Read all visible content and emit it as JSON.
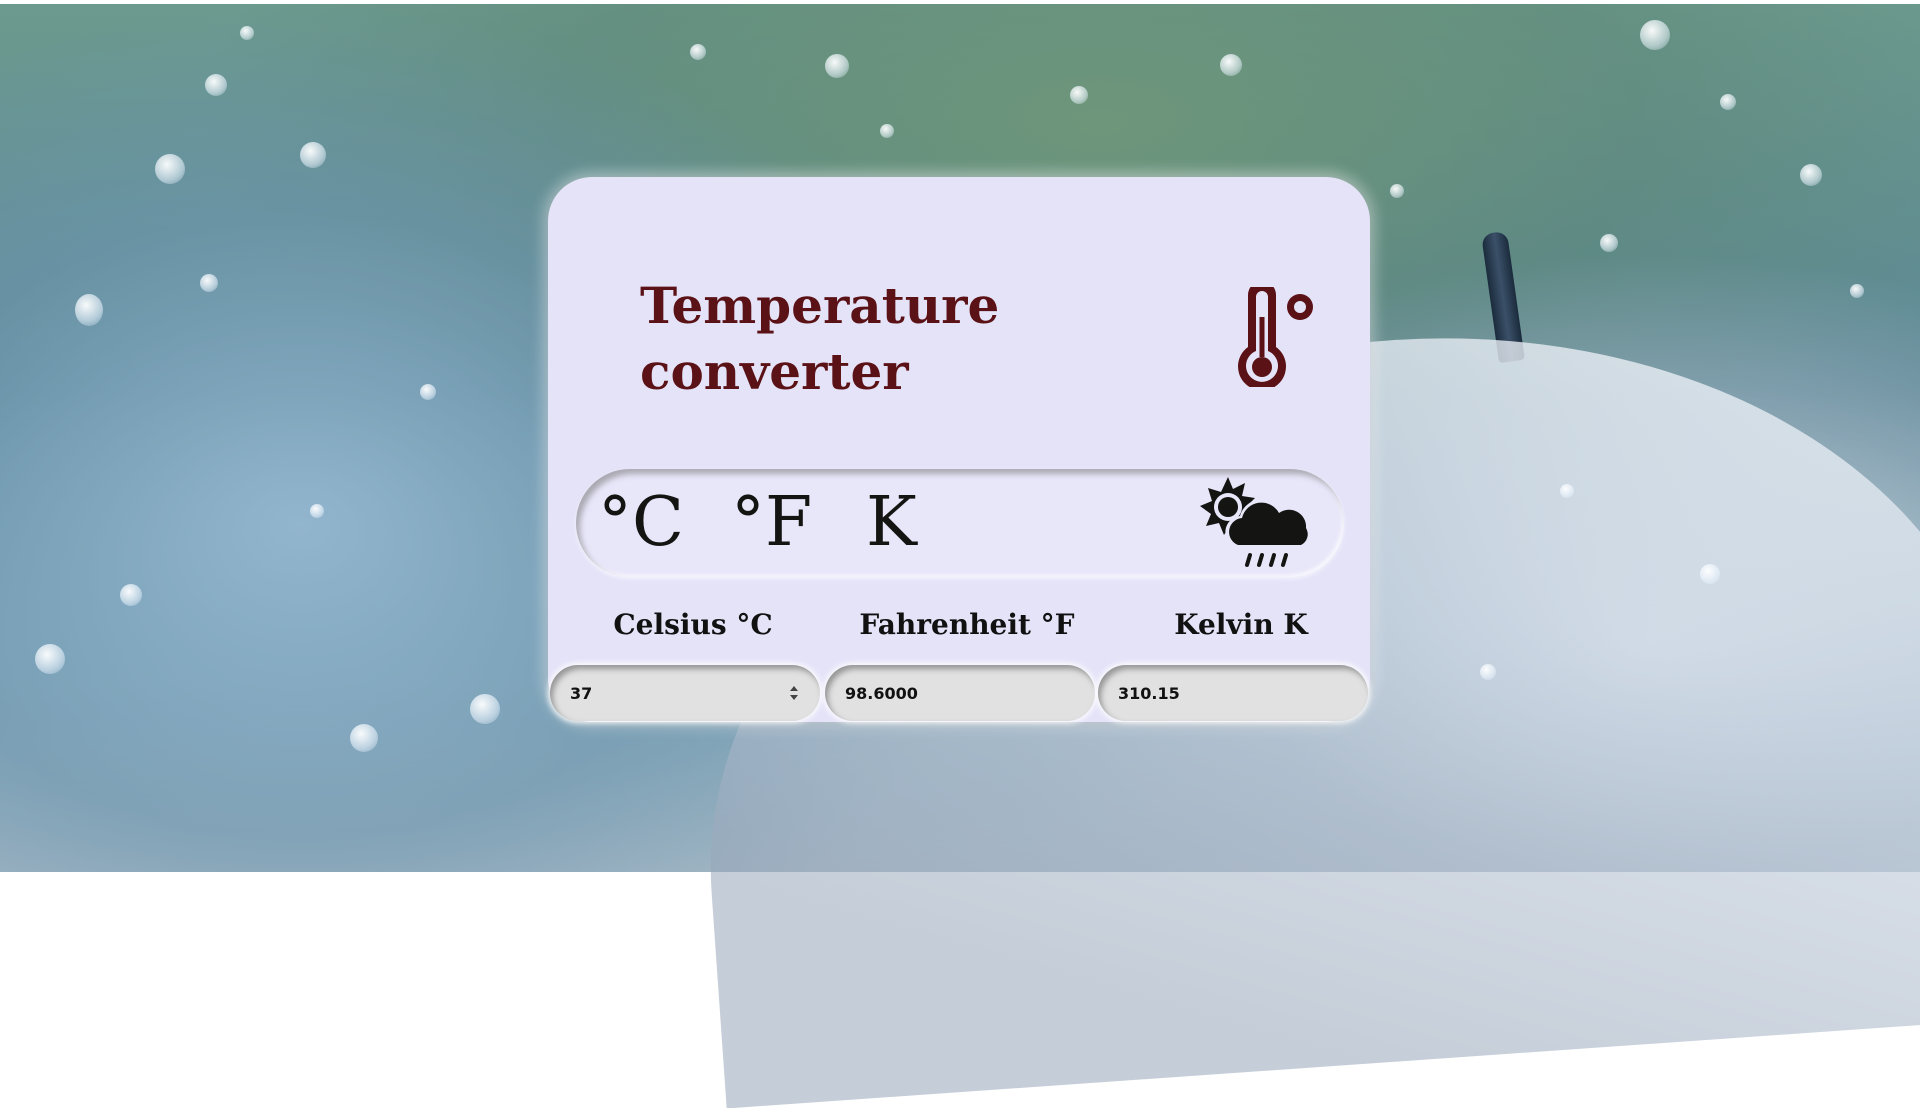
{
  "app": {
    "title": "Temperature converter",
    "title_line1": "Temperature",
    "title_line2": "converter",
    "title_color": "#5a1216",
    "card_color": "#e5e3f8"
  },
  "units": [
    {
      "label": "°C",
      "icon": "celsius"
    },
    {
      "label": "°F",
      "icon": "fahrenheit"
    },
    {
      "label": "K",
      "icon": "kelvin"
    }
  ],
  "icons": {
    "header": "thermometer-degree-icon",
    "unit_bar": "partly-cloudy-rain-icon"
  },
  "fields": {
    "celsius": {
      "label": "Celsius °C",
      "value": "37"
    },
    "fahrenheit": {
      "label": "Fahrenheit °F",
      "value": "98.6000"
    },
    "kelvin": {
      "label": "Kelvin K",
      "value": "310.15"
    }
  }
}
